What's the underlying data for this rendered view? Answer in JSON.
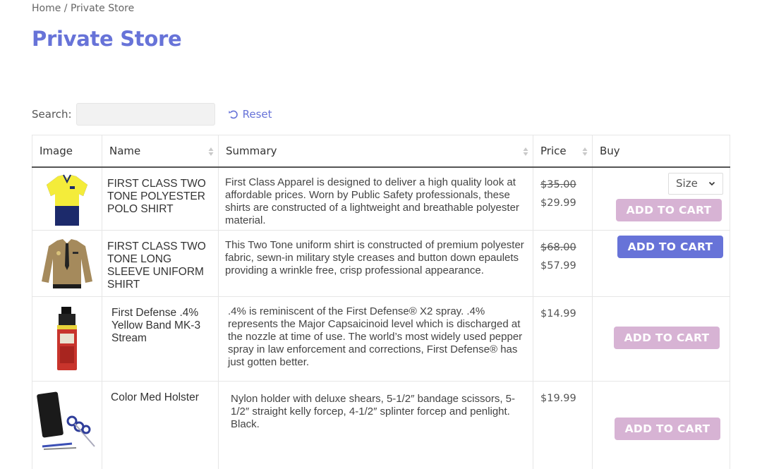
{
  "breadcrumb": {
    "home": "Home",
    "separator": " / ",
    "current": "Private Store"
  },
  "page_title": "Private Store",
  "search": {
    "label": "Search:",
    "value": "",
    "placeholder": ""
  },
  "reset_label": "Reset",
  "table": {
    "headers": {
      "image": "Image",
      "name": "Name",
      "summary": "Summary",
      "price": "Price",
      "buy": "Buy"
    },
    "rows": [
      {
        "name": "FIRST CLASS TWO TONE POLYESTER POLO SHIRT",
        "summary": "First Class Apparel is designed to deliver a high quality look at affordable prices. Worn by Public Safety professionals, these shirts are constructed of a lightweight and breathable polyester material.",
        "old_price": "$35.00",
        "price": "$29.99",
        "size_select": "Size",
        "button": "ADD TO CART"
      },
      {
        "name": "FIRST CLASS TWO TONE LONG SLEEVE UNIFORM SHIRT",
        "summary": "This Two Tone uniform shirt is constructed of premium polyester fabric, sewn-in military style creases and button down epaulets providing a wrinkle free, crisp professional appearance.",
        "old_price": "$68.00",
        "price": "$57.99",
        "button": "ADD TO CART"
      },
      {
        "name": "First Defense .4% Yellow Band MK-3 Stream",
        "summary": ".4% is reminiscent of the First Defense® X2 spray. .4% represents the Major Capsaicinoid level which is discharged at the nozzle at time of use. The world’s most widely used pepper spray in law enforcement and corrections, First Defense® has just gotten better.",
        "price": "$14.99",
        "button": "ADD TO CART"
      },
      {
        "name": "Color Med Holster",
        "summary": "Nylon holder with deluxe shears, 5-1/2″ bandage scissors, 5-1/2″ straight kelly forcep, 4-1/2″ splinter forcep and penlight. Black.",
        "price": "$19.99",
        "button": "ADD TO CART"
      }
    ]
  },
  "colors": {
    "accent": "#6773d8",
    "button_disabled": "#d7b3d4"
  }
}
